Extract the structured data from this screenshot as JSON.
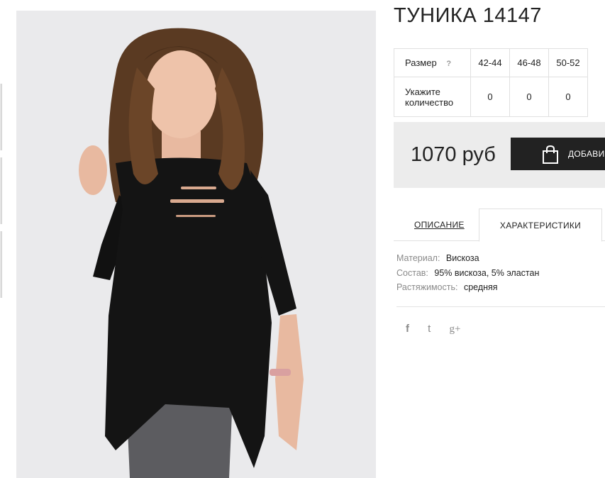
{
  "product": {
    "title": "ТУНИКА 14147",
    "price": "1070 руб",
    "add_button_label": "ДОБАВИ"
  },
  "sizes": {
    "header_label": "Размер",
    "help_icon": "?",
    "columns": [
      "42-44",
      "46-48",
      "50-52"
    ],
    "quantity_label_line1": "Укажите",
    "quantity_label_line2": "количество",
    "quantities": [
      "0",
      "0",
      "0"
    ]
  },
  "tabs": {
    "description": "ОПИСАНИЕ",
    "characteristics": "ХАРАКТЕРИСТИКИ"
  },
  "specs": [
    {
      "key": "Материал:",
      "value": "Вискоза"
    },
    {
      "key": "Состав:",
      "value": "95% вискоза, 5% эластан"
    },
    {
      "key": "Растяжимость:",
      "value": "средняя"
    }
  ],
  "social": {
    "facebook": "f",
    "twitter": "t",
    "googleplus": "g+"
  },
  "icons": {
    "bag": "shopping-bag-icon",
    "facebook": "facebook-icon",
    "twitter": "twitter-icon",
    "googleplus": "google-plus-icon"
  },
  "colors": {
    "accent": "#222222",
    "price_bg": "#ececec",
    "muted": "#8a8a8a"
  }
}
